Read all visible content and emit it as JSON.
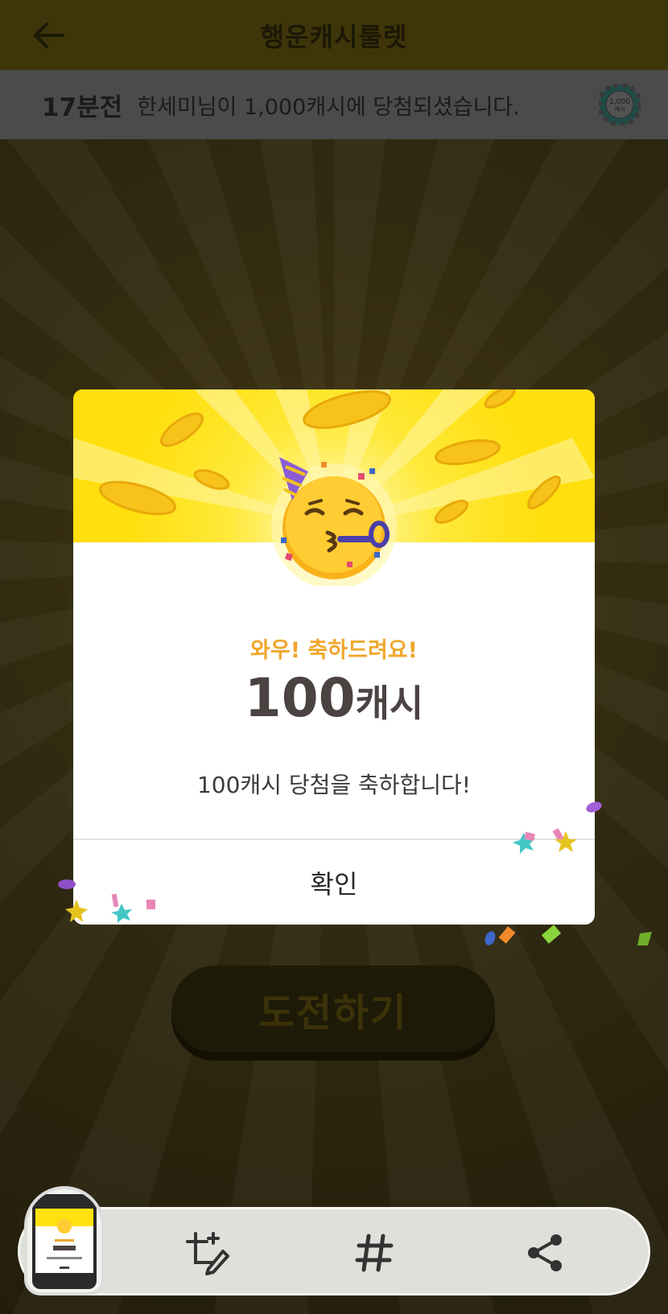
{
  "header": {
    "title": "행운캐시룰렛"
  },
  "ticker": {
    "time": "17분전",
    "message": "한세미님이 1,000캐시에 당첨되셨습니다.",
    "coin_label_top": "1,000",
    "coin_label_bottom": "캐시"
  },
  "challenge": {
    "label": "도전하기"
  },
  "modal": {
    "subtitle": "와우! 축하드려요!",
    "amount_number": "100",
    "amount_unit": "캐시",
    "message": "100캐시 당첨을 축하합니다!",
    "confirm_label": "확인"
  },
  "toolbar": {
    "icons": [
      "crop-edit-icon",
      "hashtag-icon",
      "share-icon"
    ]
  },
  "colors": {
    "accent_yellow": "#ffe112",
    "subtitle_orange": "#f0a72c",
    "amount_text": "#4b4242"
  }
}
